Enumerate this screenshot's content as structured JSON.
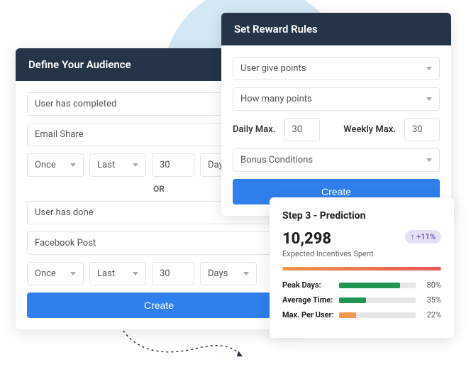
{
  "audience": {
    "title": "Define Your Audience",
    "condition1": {
      "action": "User has completed",
      "object": "Email Share",
      "freq": "Once",
      "period": "Last",
      "num": "30",
      "unit": "Days"
    },
    "divider": "OR",
    "condition2": {
      "action": "User has done",
      "object": "Facebook Post",
      "freq": "Once",
      "period": "Last",
      "num": "30",
      "unit": "Days"
    },
    "create": "Create"
  },
  "reward": {
    "title": "Set Reward Rules",
    "type": "User give points",
    "amount": "How many points",
    "daily_label": "Daily Max.",
    "daily_val": "30",
    "weekly_label": "Weekly Max.",
    "weekly_val": "30",
    "bonus": "Bonus Conditions",
    "create": "Create"
  },
  "prediction": {
    "title": "Step 3 - Prediction",
    "value": "10,298",
    "subtitle": "Expected Incentives Spent",
    "badge": "↑ +11%",
    "metrics": [
      {
        "label": "Peak Days:",
        "pct": 80,
        "color": "#219653"
      },
      {
        "label": "Average Time:",
        "pct": 35,
        "color": "#219653"
      },
      {
        "label": "Max. Per User:",
        "pct": 22,
        "color": "#f2994a"
      }
    ]
  }
}
